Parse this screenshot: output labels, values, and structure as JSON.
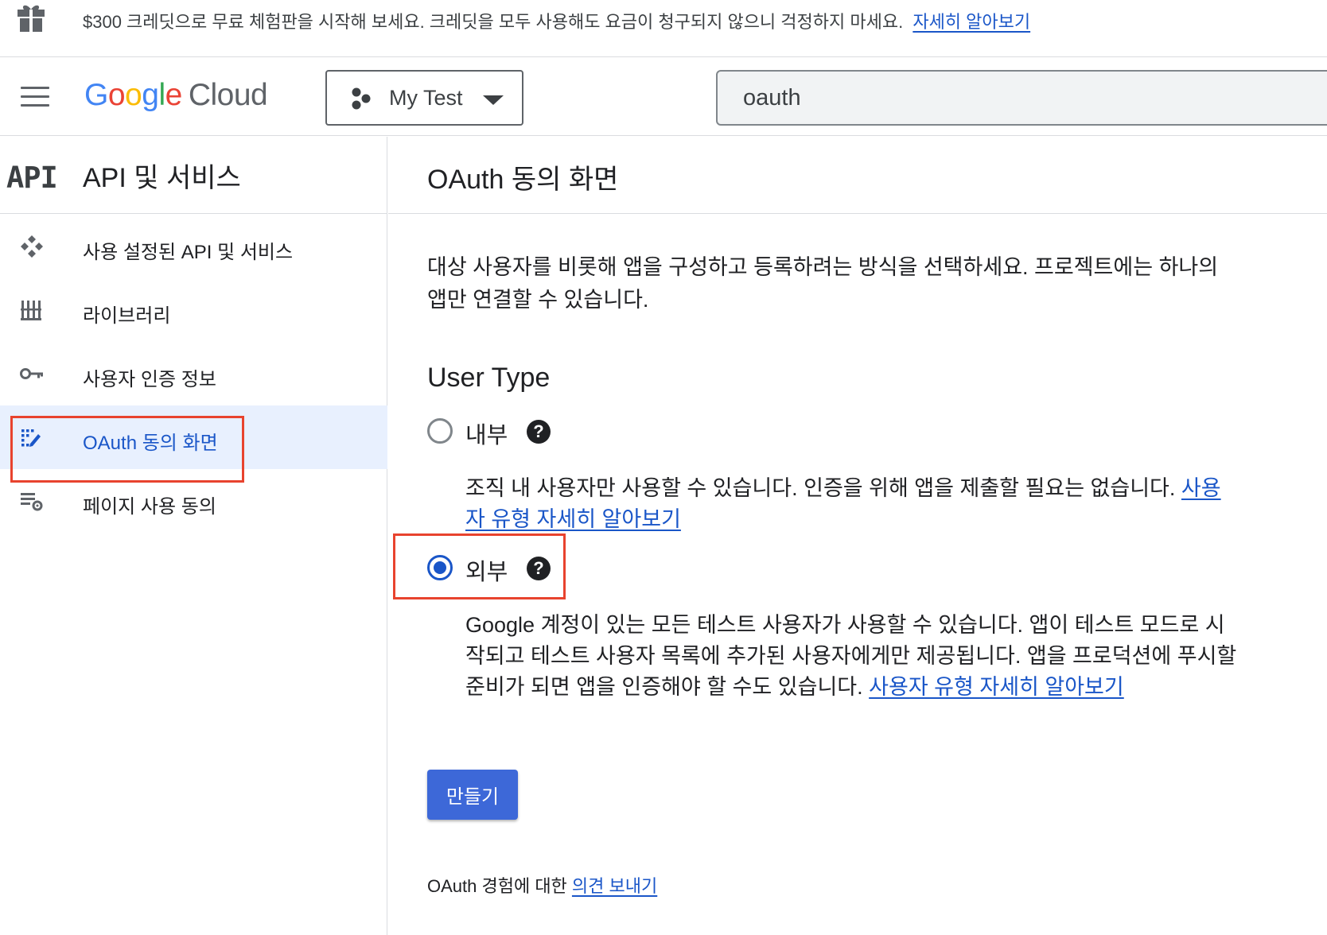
{
  "promo": {
    "text": "$300 크레딧으로 무료 체험판을 시작해 보세요. 크레딧을 모두 사용해도 요금이 청구되지 않으니 걱정하지 마세요.",
    "link": "자세히 알아보기"
  },
  "header": {
    "logo_google": [
      "G",
      "o",
      "o",
      "g",
      "l",
      "e"
    ],
    "logo_cloud": "Cloud",
    "project_name": "My Test",
    "search_value": "oauth"
  },
  "sidebar": {
    "glyph": "API",
    "title": "API 및 서비스",
    "items": [
      {
        "label": "사용 설정된 API 및 서비스",
        "icon": "enabled-apis-icon"
      },
      {
        "label": "라이브러리",
        "icon": "library-icon"
      },
      {
        "label": "사용자 인증 정보",
        "icon": "key-icon"
      },
      {
        "label": "OAuth 동의 화면",
        "icon": "oauth-consent-icon",
        "active": true
      },
      {
        "label": "페이지 사용 동의",
        "icon": "page-usage-settings-icon"
      }
    ]
  },
  "main": {
    "title": "OAuth 동의 화면",
    "description": "대상 사용자를 비롯해 앱을 구성하고 등록하려는 방식을 선택하세요. 프로젝트에는 하나의 앱만 연결할 수 있습니다.",
    "user_type_heading": "User Type",
    "internal": {
      "label": "내부",
      "help": "?",
      "description": "조직 내 사용자만 사용할 수 있습니다. 인증을 위해 앱을 제출할 필요는 없습니다.",
      "link": "사용자 유형 자세히 알아보기",
      "checked": false
    },
    "external": {
      "label": "외부",
      "help": "?",
      "description": "Google 계정이 있는 모든 테스트 사용자가 사용할 수 있습니다. 앱이 테스트 모드로 시작되고 테스트 사용자 목록에 추가된 사용자에게만 제공됩니다. 앱을 프로덕션에 푸시할 준비가 되면 앱을 인증해야 할 수도 있습니다.",
      "link": "사용자 유형 자세히 알아보기",
      "checked": true
    },
    "create_button": "만들기",
    "feedback_text": "OAuth 경험에 대한",
    "feedback_link": "의견 보내기"
  },
  "colors": {
    "accent": "#1a56c8",
    "button": "#3d68d8",
    "highlight": "#e8432e",
    "active_bg": "#e8f0fe"
  }
}
